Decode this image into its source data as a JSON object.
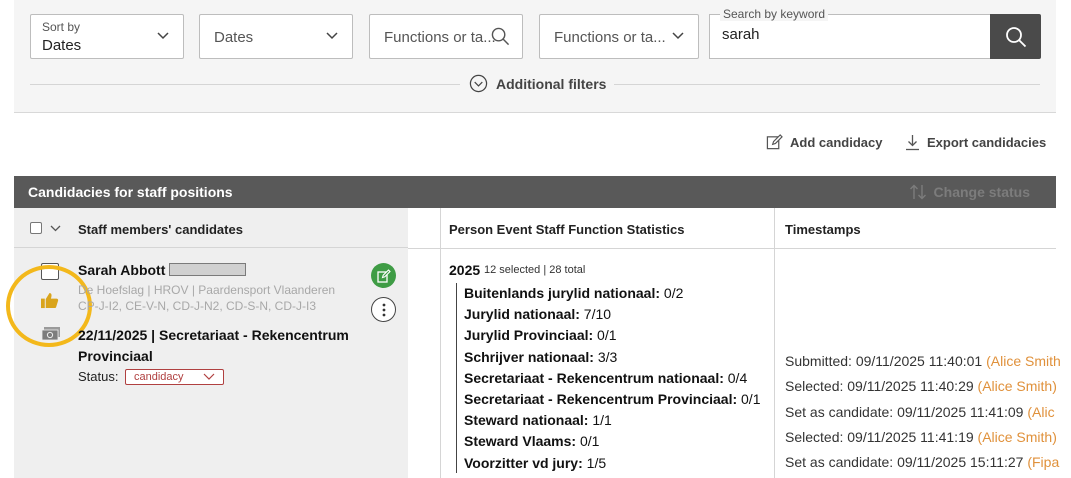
{
  "filters": {
    "sort": {
      "label": "Sort by",
      "value": "Dates"
    },
    "dates": {
      "placeholder": "Dates"
    },
    "functions_search": {
      "placeholder": "Functions or ta..."
    },
    "functions_select": {
      "placeholder": "Functions or ta..."
    },
    "keyword": {
      "label": "Search by keyword",
      "value": "sarah"
    },
    "additional": "Additional filters"
  },
  "actions": {
    "add": "Add candidacy",
    "export": "Export candidacies"
  },
  "table": {
    "title": "Candidacies for staff positions",
    "change_status": "Change status",
    "col_candidates": "Staff members' candidates",
    "col_stats": "Person Event Staff Function Statistics",
    "col_timestamps": "Timestamps"
  },
  "candidate": {
    "name": "Sarah Abbott",
    "club": "De Hoefslag | HROV | Paardensport Vlaanderen",
    "licenses": "CP-J-I2, CE-V-N, CD-J-N2, CD-S-N, CD-J-I3",
    "event": "22/11/2025 | Secretariaat - Rekencentrum Provinciaal",
    "status_label": "Status:",
    "status_value": "candidacy"
  },
  "stats": {
    "year": "2025",
    "selection": "12 selected | 28 total",
    "items": [
      {
        "name": "Buitenlands jurylid nationaal:",
        "value": "0/2"
      },
      {
        "name": "Jurylid nationaal:",
        "value": "7/10"
      },
      {
        "name": "Jurylid Provinciaal:",
        "value": "0/1"
      },
      {
        "name": "Schrijver nationaal:",
        "value": "3/3"
      },
      {
        "name": "Secretariaat - Rekencentrum nationaal:",
        "value": "0/4"
      },
      {
        "name": "Secretariaat - Rekencentrum Provinciaal:",
        "value": "0/1"
      },
      {
        "name": "Steward nationaal:",
        "value": "1/1"
      },
      {
        "name": "Steward Vlaams:",
        "value": "0/1"
      },
      {
        "name": "Voorzitter vd jury:",
        "value": "1/5"
      }
    ]
  },
  "timestamps": [
    {
      "text": "Submitted: 09/11/2025 11:40:01",
      "who": "(Alice Smith"
    },
    {
      "text": "Selected: 09/11/2025 11:40:29",
      "who": "(Alice Smith)"
    },
    {
      "text": "Set as candidate: 09/11/2025 11:41:09",
      "who": "(Alic"
    },
    {
      "text": "Selected: 09/11/2025 11:41:19",
      "who": "(Alice Smith)"
    },
    {
      "text": "Set as candidate: 09/11/2025 15:11:27",
      "who": "(Fipa"
    }
  ],
  "colors": {
    "accent_highlight": "#f3b81b",
    "edit_green": "#3f9c45",
    "status_red": "#b04040",
    "timestamp_user": "#e0913b",
    "header_dark": "#595959"
  }
}
